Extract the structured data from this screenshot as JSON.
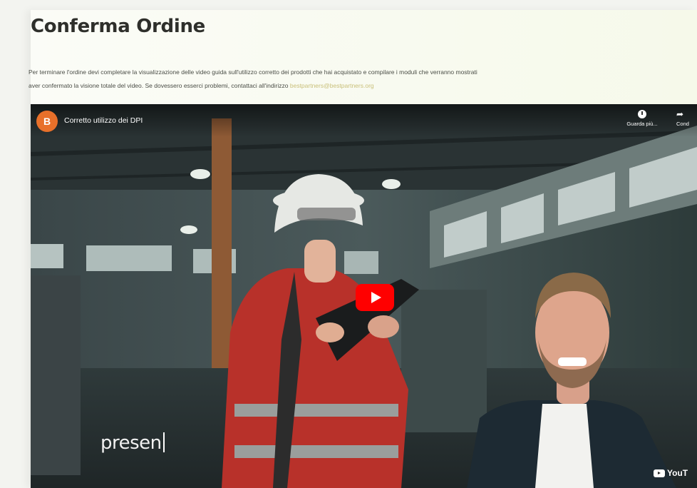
{
  "page": {
    "title": "Conferma Ordine",
    "description_line1": "Per terminare l'ordine devi completare la visualizzazione delle video guida sull'utilizzo corretto dei prodotti che hai acquistato e compilare i moduli che verranno mostrati",
    "description_line2": "aver confermato la visione totale del video. Se dovessero esserci problemi, contattaci all'indirizzo",
    "contact_email": "bestpartners@bestpartners.org"
  },
  "video": {
    "channel_initial": "B",
    "title": "Corretto utilizzo dei DPI",
    "watch_later_label": "Guarda più...",
    "share_label": "Cond",
    "caption": "presen",
    "logo_label": "YouT"
  },
  "colors": {
    "play_button": "#ff0000",
    "channel_avatar": "#e8702a",
    "email_link": "#c9c07a"
  }
}
